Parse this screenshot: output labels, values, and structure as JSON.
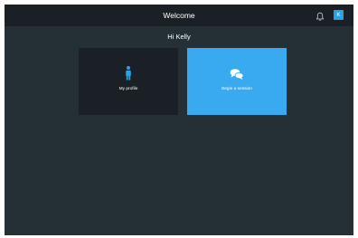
{
  "header": {
    "title": "Welcome",
    "notification_icon": "bell-icon",
    "avatar_initial": "K"
  },
  "greeting": "Hi Kelly",
  "tiles": [
    {
      "label": "My profile",
      "icon": "person-icon"
    },
    {
      "label": "Begin a session",
      "icon": "chat-bubbles-icon"
    }
  ],
  "colors": {
    "background": "#243036",
    "header": "#1a2025",
    "profile_tile": "#1a2025",
    "session_tile": "#3aaaf0",
    "accent_icon": "#2aa1e6",
    "text": "#ffffff"
  }
}
